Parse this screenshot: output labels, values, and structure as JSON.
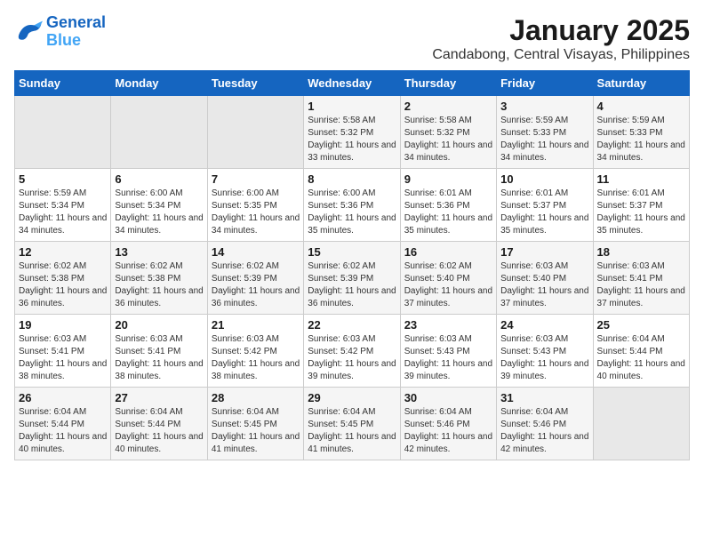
{
  "header": {
    "logo_line1": "General",
    "logo_line2": "Blue",
    "title": "January 2025",
    "subtitle": "Candabong, Central Visayas, Philippines"
  },
  "days_of_week": [
    "Sunday",
    "Monday",
    "Tuesday",
    "Wednesday",
    "Thursday",
    "Friday",
    "Saturday"
  ],
  "weeks": [
    [
      {
        "day": "",
        "sunrise": "",
        "sunset": "",
        "daylight": "",
        "empty": true
      },
      {
        "day": "",
        "sunrise": "",
        "sunset": "",
        "daylight": "",
        "empty": true
      },
      {
        "day": "",
        "sunrise": "",
        "sunset": "",
        "daylight": "",
        "empty": true
      },
      {
        "day": "1",
        "sunrise": "Sunrise: 5:58 AM",
        "sunset": "Sunset: 5:32 PM",
        "daylight": "Daylight: 11 hours and 33 minutes."
      },
      {
        "day": "2",
        "sunrise": "Sunrise: 5:58 AM",
        "sunset": "Sunset: 5:32 PM",
        "daylight": "Daylight: 11 hours and 34 minutes."
      },
      {
        "day": "3",
        "sunrise": "Sunrise: 5:59 AM",
        "sunset": "Sunset: 5:33 PM",
        "daylight": "Daylight: 11 hours and 34 minutes."
      },
      {
        "day": "4",
        "sunrise": "Sunrise: 5:59 AM",
        "sunset": "Sunset: 5:33 PM",
        "daylight": "Daylight: 11 hours and 34 minutes."
      }
    ],
    [
      {
        "day": "5",
        "sunrise": "Sunrise: 5:59 AM",
        "sunset": "Sunset: 5:34 PM",
        "daylight": "Daylight: 11 hours and 34 minutes."
      },
      {
        "day": "6",
        "sunrise": "Sunrise: 6:00 AM",
        "sunset": "Sunset: 5:34 PM",
        "daylight": "Daylight: 11 hours and 34 minutes."
      },
      {
        "day": "7",
        "sunrise": "Sunrise: 6:00 AM",
        "sunset": "Sunset: 5:35 PM",
        "daylight": "Daylight: 11 hours and 34 minutes."
      },
      {
        "day": "8",
        "sunrise": "Sunrise: 6:00 AM",
        "sunset": "Sunset: 5:36 PM",
        "daylight": "Daylight: 11 hours and 35 minutes."
      },
      {
        "day": "9",
        "sunrise": "Sunrise: 6:01 AM",
        "sunset": "Sunset: 5:36 PM",
        "daylight": "Daylight: 11 hours and 35 minutes."
      },
      {
        "day": "10",
        "sunrise": "Sunrise: 6:01 AM",
        "sunset": "Sunset: 5:37 PM",
        "daylight": "Daylight: 11 hours and 35 minutes."
      },
      {
        "day": "11",
        "sunrise": "Sunrise: 6:01 AM",
        "sunset": "Sunset: 5:37 PM",
        "daylight": "Daylight: 11 hours and 35 minutes."
      }
    ],
    [
      {
        "day": "12",
        "sunrise": "Sunrise: 6:02 AM",
        "sunset": "Sunset: 5:38 PM",
        "daylight": "Daylight: 11 hours and 36 minutes."
      },
      {
        "day": "13",
        "sunrise": "Sunrise: 6:02 AM",
        "sunset": "Sunset: 5:38 PM",
        "daylight": "Daylight: 11 hours and 36 minutes."
      },
      {
        "day": "14",
        "sunrise": "Sunrise: 6:02 AM",
        "sunset": "Sunset: 5:39 PM",
        "daylight": "Daylight: 11 hours and 36 minutes."
      },
      {
        "day": "15",
        "sunrise": "Sunrise: 6:02 AM",
        "sunset": "Sunset: 5:39 PM",
        "daylight": "Daylight: 11 hours and 36 minutes."
      },
      {
        "day": "16",
        "sunrise": "Sunrise: 6:02 AM",
        "sunset": "Sunset: 5:40 PM",
        "daylight": "Daylight: 11 hours and 37 minutes."
      },
      {
        "day": "17",
        "sunrise": "Sunrise: 6:03 AM",
        "sunset": "Sunset: 5:40 PM",
        "daylight": "Daylight: 11 hours and 37 minutes."
      },
      {
        "day": "18",
        "sunrise": "Sunrise: 6:03 AM",
        "sunset": "Sunset: 5:41 PM",
        "daylight": "Daylight: 11 hours and 37 minutes."
      }
    ],
    [
      {
        "day": "19",
        "sunrise": "Sunrise: 6:03 AM",
        "sunset": "Sunset: 5:41 PM",
        "daylight": "Daylight: 11 hours and 38 minutes."
      },
      {
        "day": "20",
        "sunrise": "Sunrise: 6:03 AM",
        "sunset": "Sunset: 5:41 PM",
        "daylight": "Daylight: 11 hours and 38 minutes."
      },
      {
        "day": "21",
        "sunrise": "Sunrise: 6:03 AM",
        "sunset": "Sunset: 5:42 PM",
        "daylight": "Daylight: 11 hours and 38 minutes."
      },
      {
        "day": "22",
        "sunrise": "Sunrise: 6:03 AM",
        "sunset": "Sunset: 5:42 PM",
        "daylight": "Daylight: 11 hours and 39 minutes."
      },
      {
        "day": "23",
        "sunrise": "Sunrise: 6:03 AM",
        "sunset": "Sunset: 5:43 PM",
        "daylight": "Daylight: 11 hours and 39 minutes."
      },
      {
        "day": "24",
        "sunrise": "Sunrise: 6:03 AM",
        "sunset": "Sunset: 5:43 PM",
        "daylight": "Daylight: 11 hours and 39 minutes."
      },
      {
        "day": "25",
        "sunrise": "Sunrise: 6:04 AM",
        "sunset": "Sunset: 5:44 PM",
        "daylight": "Daylight: 11 hours and 40 minutes."
      }
    ],
    [
      {
        "day": "26",
        "sunrise": "Sunrise: 6:04 AM",
        "sunset": "Sunset: 5:44 PM",
        "daylight": "Daylight: 11 hours and 40 minutes."
      },
      {
        "day": "27",
        "sunrise": "Sunrise: 6:04 AM",
        "sunset": "Sunset: 5:44 PM",
        "daylight": "Daylight: 11 hours and 40 minutes."
      },
      {
        "day": "28",
        "sunrise": "Sunrise: 6:04 AM",
        "sunset": "Sunset: 5:45 PM",
        "daylight": "Daylight: 11 hours and 41 minutes."
      },
      {
        "day": "29",
        "sunrise": "Sunrise: 6:04 AM",
        "sunset": "Sunset: 5:45 PM",
        "daylight": "Daylight: 11 hours and 41 minutes."
      },
      {
        "day": "30",
        "sunrise": "Sunrise: 6:04 AM",
        "sunset": "Sunset: 5:46 PM",
        "daylight": "Daylight: 11 hours and 42 minutes."
      },
      {
        "day": "31",
        "sunrise": "Sunrise: 6:04 AM",
        "sunset": "Sunset: 5:46 PM",
        "daylight": "Daylight: 11 hours and 42 minutes."
      },
      {
        "day": "",
        "sunrise": "",
        "sunset": "",
        "daylight": "",
        "empty": true
      }
    ]
  ]
}
